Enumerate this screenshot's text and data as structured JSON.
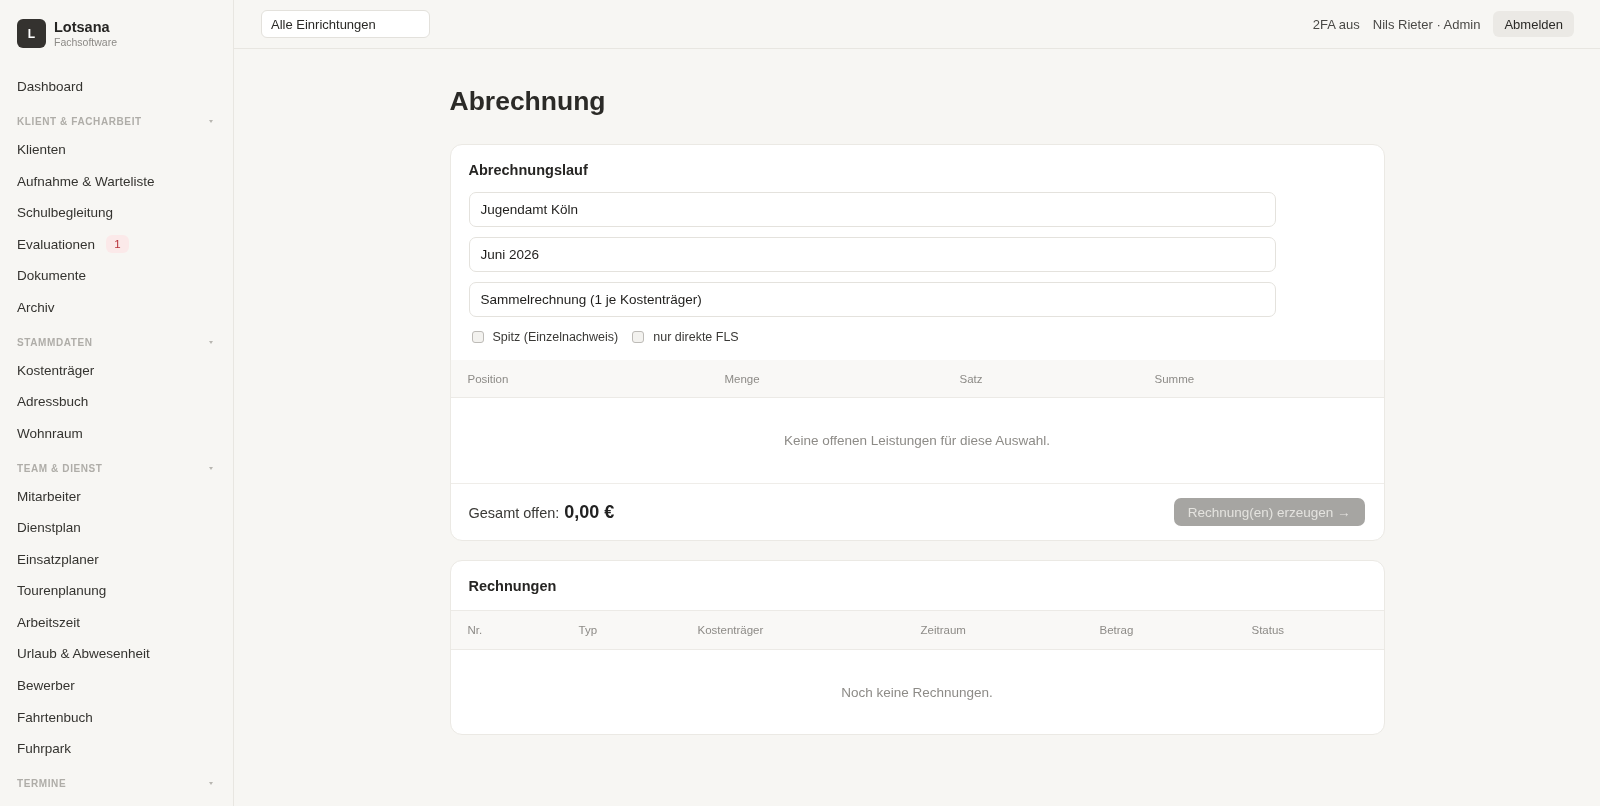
{
  "brand": {
    "logo_letter": "L",
    "name": "Lotsana",
    "subtitle": "Fachsoftware"
  },
  "sidebar": {
    "groups": [
      {
        "items": [
          {
            "label": "Dashboard",
            "selected": false
          }
        ]
      },
      {
        "title": "KLIENT & FACHARBEIT",
        "items": [
          {
            "label": "Klienten",
            "selected": false
          },
          {
            "label": "Aufnahme & Warteliste",
            "selected": false
          },
          {
            "label": "Schulbegleitung",
            "selected": false
          },
          {
            "label": "Evaluationen",
            "badge": "1",
            "selected": false
          },
          {
            "label": "Dokumente",
            "selected": false
          },
          {
            "label": "Archiv",
            "selected": false
          }
        ]
      },
      {
        "title": "STAMMDATEN",
        "items": [
          {
            "label": "Kostenträger",
            "selected": false
          },
          {
            "label": "Adressbuch",
            "selected": false
          },
          {
            "label": "Wohnraum",
            "selected": false
          }
        ]
      },
      {
        "title": "TEAM & DIENST",
        "items": [
          {
            "label": "Mitarbeiter",
            "selected": false
          },
          {
            "label": "Dienstplan",
            "selected": false
          },
          {
            "label": "Einsatzplaner",
            "selected": false
          },
          {
            "label": "Tourenplanung",
            "selected": false
          },
          {
            "label": "Arbeitszeit",
            "selected": false
          },
          {
            "label": "Urlaub & Abwesenheit",
            "selected": false
          },
          {
            "label": "Bewerber",
            "selected": false
          },
          {
            "label": "Fahrtenbuch",
            "selected": false
          },
          {
            "label": "Fuhrpark",
            "selected": false
          }
        ]
      },
      {
        "title": "TERMINE"
      }
    ]
  },
  "top_bar": {
    "facility_select": {
      "value": "Alle Einrichtungen"
    },
    "two_factor_status": "2FA aus",
    "user": "Nils Rieter · Admin",
    "logout_button": "Abmelden"
  },
  "page": {
    "title": "Abrechnung"
  },
  "billing_run": {
    "title": "Abrechnungslauf",
    "fields": [
      {
        "value": "Jugendamt Köln"
      },
      {
        "value": "Juni 2026"
      },
      {
        "value": "Sammelrechnung (1 je Kostenträger)"
      }
    ],
    "options": [
      {
        "label": "Spitz (Einzelnachweis)",
        "checked": false
      },
      {
        "label": "nur direkte FLS",
        "checked": false
      }
    ],
    "table": {
      "columns": [
        "Position",
        "Menge",
        "Satz",
        "Summe"
      ],
      "empty_text": "Keine offenen Leistungen für diese Auswahl."
    },
    "total_label": "Gesamt offen:",
    "total_value": "0,00 €",
    "submit_button": {
      "label": "Rechnung(en) erzeugen →",
      "disabled": true
    }
  },
  "invoices": {
    "title": "Rechnungen",
    "table": {
      "columns": [
        "Nr.",
        "Typ",
        "Kostenträger",
        "Zeitraum",
        "Betrag",
        "Status"
      ],
      "empty_text": "Noch keine Rechnungen."
    }
  }
}
